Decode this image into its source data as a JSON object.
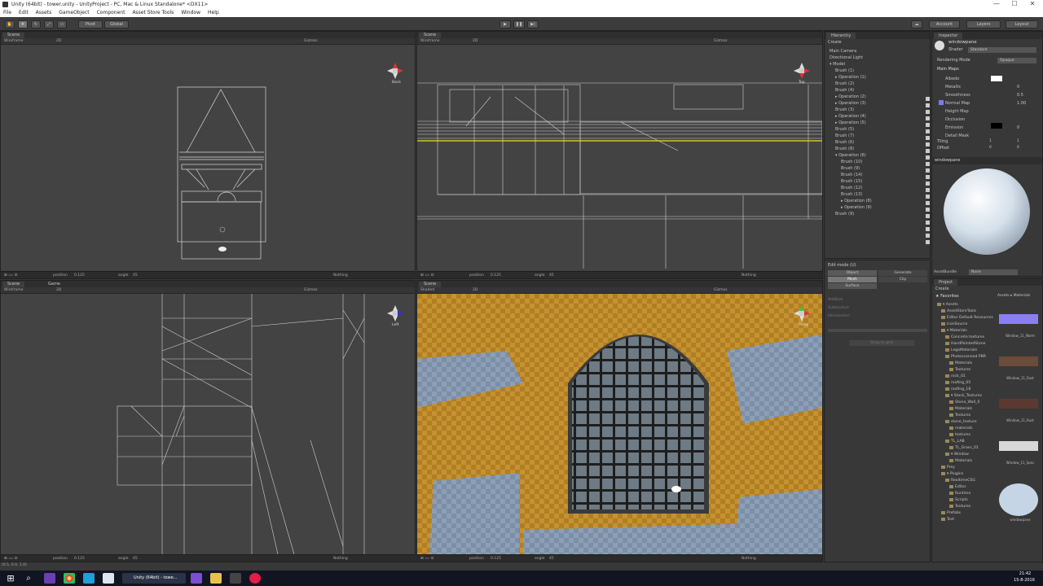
{
  "window": {
    "title": "Unity (64bit) - tower.unity - UnityProject - PC, Mac & Linux Standalone* <DX11>",
    "controls": [
      "—",
      "☐",
      "✕"
    ]
  },
  "menu": [
    "File",
    "Edit",
    "Assets",
    "GameObject",
    "Component",
    "Asset Store Tools",
    "Window",
    "Help"
  ],
  "toolbar": {
    "pivot": "Pivot",
    "global": "Global",
    "account": "Account",
    "layers": "Layers",
    "layout": "Layout"
  },
  "scene_views": [
    {
      "tab": "Scene",
      "mode": "Wireframe",
      "label": "Back",
      "bottom_pos": "0.125",
      "bottom_angle": "45",
      "nothing": "Nothing"
    },
    {
      "tab": "Scene",
      "mode": "Wireframe",
      "label": "Top",
      "bottom_pos": "0.125",
      "bottom_angle": "45",
      "nothing": "Nothing"
    },
    {
      "tab": "Scene",
      "mode": "Wireframe",
      "label": "Left",
      "bottom_pos": "0.125",
      "bottom_angle": "45",
      "nothing": "Nothing"
    },
    {
      "tab": "Scene",
      "mode": "Shaded",
      "label": "Persp",
      "bottom_pos": "0.125",
      "bottom_angle": "45",
      "nothing": "Nothing"
    }
  ],
  "game_tab": "Game",
  "hierarchy": {
    "tab": "Hierarchy",
    "create": "Create",
    "items": [
      {
        "label": "Main Camera",
        "indent": 0
      },
      {
        "label": "Directional Light",
        "indent": 0
      },
      {
        "label": "▾ Model",
        "indent": 0
      },
      {
        "label": "Brush (1)",
        "indent": 1
      },
      {
        "label": "▸ Operation (1)",
        "indent": 1
      },
      {
        "label": "Brush (2)",
        "indent": 1
      },
      {
        "label": "Brush (4)",
        "indent": 1
      },
      {
        "label": "▸ Operation (2)",
        "indent": 1
      },
      {
        "label": "▸ Operation (3)",
        "indent": 1
      },
      {
        "label": "Brush (3)",
        "indent": 1
      },
      {
        "label": "▸ Operation (4)",
        "indent": 1
      },
      {
        "label": "▸ Operation (5)",
        "indent": 1
      },
      {
        "label": "Brush (5)",
        "indent": 1
      },
      {
        "label": "Brush (7)",
        "indent": 1
      },
      {
        "label": "Brush (6)",
        "indent": 1
      },
      {
        "label": "Brush (8)",
        "indent": 1
      },
      {
        "label": "▾ Operation (6)",
        "indent": 1
      },
      {
        "label": "Brush (10)",
        "indent": 2
      },
      {
        "label": "Brush (9)",
        "indent": 2
      },
      {
        "label": "Brush (14)",
        "indent": 2
      },
      {
        "label": "Brush (15)",
        "indent": 2
      },
      {
        "label": "Brush (12)",
        "indent": 2
      },
      {
        "label": "Brush (13)",
        "indent": 2
      },
      {
        "label": "▸ Operation (8)",
        "indent": 2
      },
      {
        "label": "▸ Operation (9)",
        "indent": 2
      },
      {
        "label": "Brush (9)",
        "indent": 1
      }
    ]
  },
  "edit_mode": {
    "title": "Edit mode (U)",
    "object": "Object",
    "generate": "Generate",
    "mesh": "Mesh",
    "clip": "Clip",
    "surface": "Surface",
    "options": [
      "Additive",
      "Subtractive",
      "Intersection"
    ],
    "snap": "Snap to grid"
  },
  "inspector": {
    "tab": "Inspector",
    "material": "windowpane",
    "shader_label": "Shader",
    "shader_value": "Standard",
    "rendering_mode_label": "Rendering Mode",
    "rendering_mode_value": "Opaque",
    "main_maps": "Main Maps",
    "rows": [
      {
        "label": "Albedo",
        "value": ""
      },
      {
        "label": "Metallic",
        "value": "0"
      },
      {
        "label": "Smoothness",
        "value": "0.5"
      },
      {
        "label": "Normal Map",
        "value": "1.00"
      },
      {
        "label": "Height Map",
        "value": ""
      },
      {
        "label": "Occlusion",
        "value": ""
      },
      {
        "label": "Emission",
        "value": "0"
      },
      {
        "label": "Detail Mask",
        "value": ""
      }
    ],
    "tiling": "Tiling",
    "offset": "Offset",
    "tiling_x": "1",
    "tiling_y": "1",
    "offset_x": "0",
    "offset_y": "0",
    "preview_title": "windowpane",
    "assetbundle": "AssetBundle",
    "assetbundle_value": "None"
  },
  "project": {
    "tab": "Project",
    "create": "Create",
    "breadcrumb": "Assets ▸ Materials",
    "favorites": "★ Favorites",
    "tree": [
      {
        "label": "▾ Assets",
        "indent": 0
      },
      {
        "label": "AssetStoreTools",
        "indent": 1
      },
      {
        "label": "Editor Default Resources",
        "indent": 1
      },
      {
        "label": "IconSource",
        "indent": 1
      },
      {
        "label": "▾ Materials",
        "indent": 1
      },
      {
        "label": "Concrete textures",
        "indent": 2
      },
      {
        "label": "HandPaintedStone",
        "indent": 2
      },
      {
        "label": "LegoMaterials",
        "indent": 2
      },
      {
        "label": "Photoscanned PBR",
        "indent": 2
      },
      {
        "label": "Materials",
        "indent": 3
      },
      {
        "label": "Textures",
        "indent": 3
      },
      {
        "label": "rock_01",
        "indent": 2
      },
      {
        "label": "roofing_05",
        "indent": 2
      },
      {
        "label": "roofing_18",
        "indent": 2
      },
      {
        "label": "▾ Stock_Textures",
        "indent": 2
      },
      {
        "label": "Stone_Wall_0",
        "indent": 3
      },
      {
        "label": "Materials",
        "indent": 3
      },
      {
        "label": "Textures",
        "indent": 3
      },
      {
        "label": "stone_texture",
        "indent": 2
      },
      {
        "label": "materials",
        "indent": 3
      },
      {
        "label": "textures",
        "indent": 3
      },
      {
        "label": "TL_LAB",
        "indent": 2
      },
      {
        "label": "TL_Grass_01",
        "indent": 3
      },
      {
        "label": "▾ Window",
        "indent": 2
      },
      {
        "label": "Materials",
        "indent": 3
      },
      {
        "label": "Prey",
        "indent": 1
      },
      {
        "label": "▾ Plugins",
        "indent": 1
      },
      {
        "label": "RealtimeCSG",
        "indent": 2
      },
      {
        "label": "Editor",
        "indent": 3
      },
      {
        "label": "Runtime",
        "indent": 3
      },
      {
        "label": "Scripts",
        "indent": 3
      },
      {
        "label": "Textures",
        "indent": 3
      },
      {
        "label": "Prefabs",
        "indent": 1
      },
      {
        "label": "Test",
        "indent": 1
      }
    ],
    "assets": [
      {
        "label": "Window_11_Norm",
        "color": "#8a7ef5"
      },
      {
        "label": "Window_11_Rust",
        "color": "#6b4b3a"
      },
      {
        "label": "Window_11_Rust",
        "color": "#5a3a30"
      },
      {
        "label": "Window_11_Spec",
        "color": "#d8d8d8"
      },
      {
        "label": "windowpane",
        "color": "#c5d5e5"
      }
    ]
  },
  "taskbar": {
    "time": "21:42",
    "date": "15-8-2016",
    "active_app": "Unity (64bit) - towe..."
  },
  "status": "(0.5, 0.0, 1.0)"
}
